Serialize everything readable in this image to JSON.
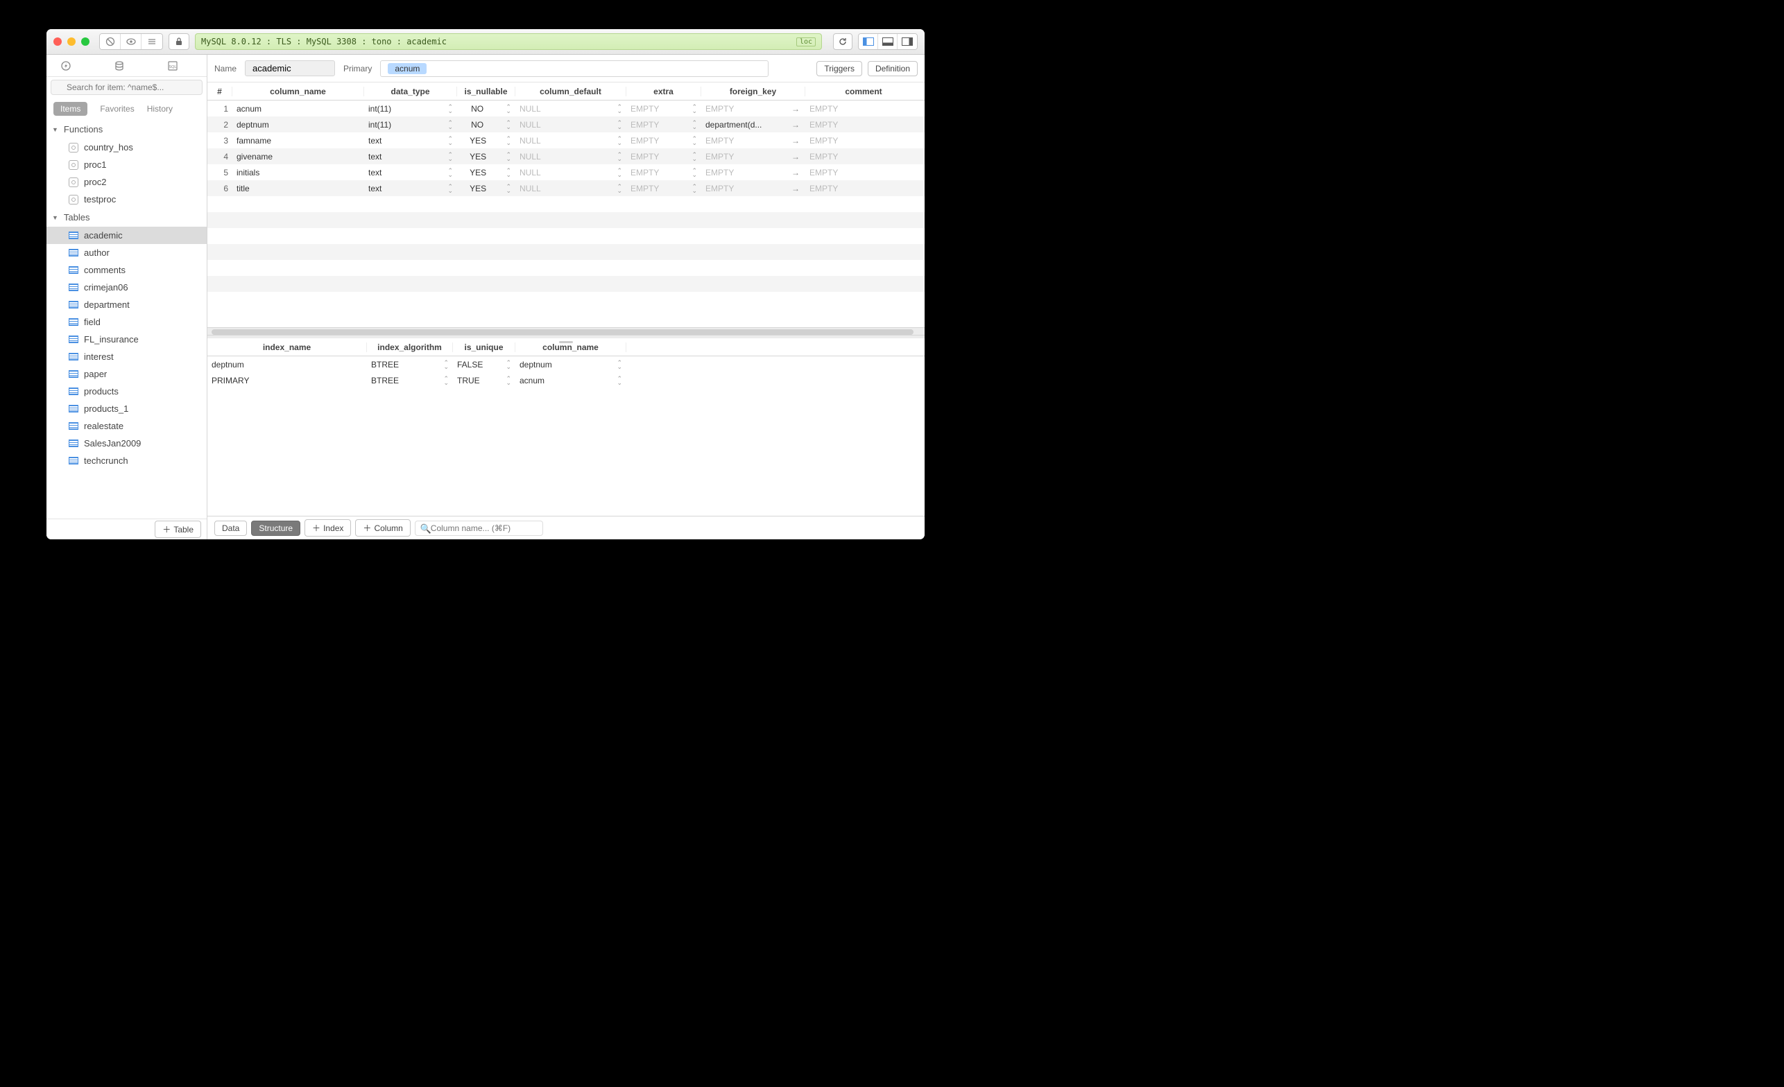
{
  "titlebar": {
    "connection": "MySQL 8.0.12 : TLS : MySQL 3308 : tono : academic",
    "badge": "loc"
  },
  "sidebar": {
    "search_placeholder": "Search for item: ^name$...",
    "tabs": {
      "items": "Items",
      "favorites": "Favorites",
      "history": "History"
    },
    "functions_label": "Functions",
    "functions": [
      {
        "name": "country_hos"
      },
      {
        "name": "proc1"
      },
      {
        "name": "proc2"
      },
      {
        "name": "testproc"
      }
    ],
    "tables_label": "Tables",
    "tables": [
      {
        "name": "academic"
      },
      {
        "name": "author"
      },
      {
        "name": "comments"
      },
      {
        "name": "crimejan06"
      },
      {
        "name": "department"
      },
      {
        "name": "field"
      },
      {
        "name": "FL_insurance"
      },
      {
        "name": "interest"
      },
      {
        "name": "paper"
      },
      {
        "name": "products"
      },
      {
        "name": "products_1"
      },
      {
        "name": "realestate"
      },
      {
        "name": "SalesJan2009"
      },
      {
        "name": "techcrunch"
      }
    ],
    "add_table_btn": "Table"
  },
  "header": {
    "name_label": "Name",
    "name_value": "academic",
    "primary_label": "Primary",
    "primary_chip": "acnum",
    "triggers_btn": "Triggers",
    "definition_btn": "Definition"
  },
  "columns": {
    "headers": {
      "idx": "#",
      "name": "column_name",
      "type": "data_type",
      "nullable": "is_nullable",
      "default": "column_default",
      "extra": "extra",
      "fk": "foreign_key",
      "comment": "comment"
    },
    "rows": [
      {
        "idx": "1",
        "name": "acnum",
        "type": "int(11)",
        "nullable": "NO",
        "default": "NULL",
        "extra": "EMPTY",
        "fk": "EMPTY",
        "comment": "EMPTY"
      },
      {
        "idx": "2",
        "name": "deptnum",
        "type": "int(11)",
        "nullable": "NO",
        "default": "NULL",
        "extra": "EMPTY",
        "fk": "department(d...",
        "comment": "EMPTY"
      },
      {
        "idx": "3",
        "name": "famname",
        "type": "text",
        "nullable": "YES",
        "default": "NULL",
        "extra": "EMPTY",
        "fk": "EMPTY",
        "comment": "EMPTY"
      },
      {
        "idx": "4",
        "name": "givename",
        "type": "text",
        "nullable": "YES",
        "default": "NULL",
        "extra": "EMPTY",
        "fk": "EMPTY",
        "comment": "EMPTY"
      },
      {
        "idx": "5",
        "name": "initials",
        "type": "text",
        "nullable": "YES",
        "default": "NULL",
        "extra": "EMPTY",
        "fk": "EMPTY",
        "comment": "EMPTY"
      },
      {
        "idx": "6",
        "name": "title",
        "type": "text",
        "nullable": "YES",
        "default": "NULL",
        "extra": "EMPTY",
        "fk": "EMPTY",
        "comment": "EMPTY"
      }
    ]
  },
  "indexes": {
    "headers": {
      "name": "index_name",
      "algo": "index_algorithm",
      "unique": "is_unique",
      "col": "column_name"
    },
    "rows": [
      {
        "name": "deptnum",
        "algo": "BTREE",
        "unique": "FALSE",
        "col": "deptnum"
      },
      {
        "name": "PRIMARY",
        "algo": "BTREE",
        "unique": "TRUE",
        "col": "acnum"
      }
    ]
  },
  "footer": {
    "data_btn": "Data",
    "structure_btn": "Structure",
    "index_btn": "Index",
    "column_btn": "Column",
    "search_placeholder": "Column name... (⌘F)"
  }
}
